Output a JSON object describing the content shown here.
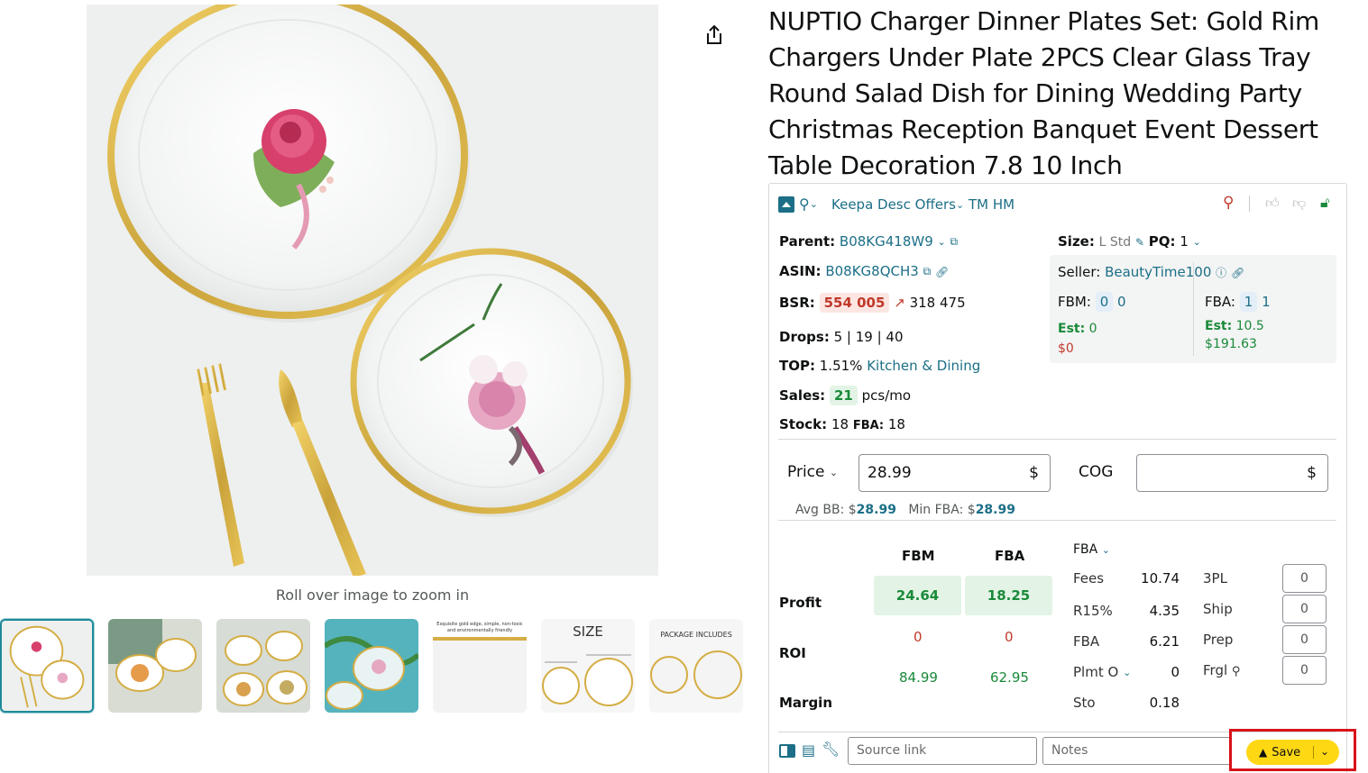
{
  "gallery": {
    "zoom_hint": "Roll over image to zoom in",
    "thumb_size_label": "SIZE",
    "thumb_package_label": "PACKAGE INCLUDES",
    "thumb_text_label": "Exquisite gold edge, simple, non-toxic and environmentally friendly"
  },
  "product": {
    "title": "NUPTIO Charger Dinner Plates Set: Gold Rim Chargers Under Plate 2PCS Clear Glass Tray Round Salad Dish for Dining Wedding Party Christmas Reception Banquet Event Dessert Table Decoration 7.8 10 Inch"
  },
  "keepa": {
    "toolbar": {
      "links": "Keepa Desc Offers",
      "tm_hm": "TM HM"
    },
    "parent": {
      "label": "Parent:",
      "value": "B08KG418W9"
    },
    "asin": {
      "label": "ASIN:",
      "value": "B08KG8QCH3"
    },
    "bsr": {
      "label": "BSR:",
      "value": "554 005",
      "prev": "318 475"
    },
    "drops": {
      "label": "Drops:",
      "value": "5 | 19 | 40"
    },
    "top": {
      "label": "TOP:",
      "value": "1.51%",
      "category": "Kitchen & Dining"
    },
    "sales": {
      "label": "Sales:",
      "value": "21",
      "unit": "pcs/mo"
    },
    "stock": {
      "label": "Stock:",
      "value": "18",
      "fba_label": "FBA:",
      "fba_value": "18"
    },
    "size": {
      "label": "Size:",
      "value": "L Std",
      "pq_label": "PQ:",
      "pq_value": "1"
    },
    "seller": {
      "label": "Seller:",
      "name": "BeautyTime100",
      "fbm_label": "FBM:",
      "fbm_a": "0",
      "fbm_b": "0",
      "fba_label": "FBA:",
      "fba_a": "1",
      "fba_b": "1",
      "est_label": "Est:",
      "est_fbm": "0",
      "est_fbm_money": "$0",
      "est_fba": "10.5",
      "est_fba_money": "$191.63"
    },
    "price": {
      "label": "Price",
      "value": "28.99",
      "currency": "$"
    },
    "cog": {
      "label": "COG",
      "value": "",
      "currency": "$"
    },
    "bb": {
      "avg_label": "Avg BB: $",
      "avg_value": "28.99",
      "min_label": "Min FBA: $",
      "min_value": "28.99"
    },
    "calc": {
      "fbm_header": "FBM",
      "fba_header": "FBA",
      "profit_label": "Profit",
      "roi_label": "ROI",
      "margin_label": "Margin",
      "profit_fbm": "24.64",
      "profit_fba": "18.25",
      "roi_fbm": "0",
      "roi_fba": "0",
      "margin_fbm": "84.99",
      "margin_fba": "62.95"
    },
    "fees": {
      "mode": "FBA",
      "rows": [
        {
          "label": "Fees",
          "value": "10.74"
        },
        {
          "label": "R15%",
          "value": "4.35"
        },
        {
          "label": "FBA",
          "value": "6.21"
        },
        {
          "label": "Plmt O",
          "value": "0"
        },
        {
          "label": "Sto",
          "value": "0.18"
        }
      ],
      "extras": [
        {
          "label": "3PL",
          "value": "0"
        },
        {
          "label": "Ship",
          "value": "0"
        },
        {
          "label": "Prep",
          "value": "0"
        },
        {
          "label": "Frgl",
          "value": "0"
        }
      ]
    },
    "bottom": {
      "source_placeholder": "Source link",
      "notes_placeholder": "Notes",
      "save_label": "Save"
    }
  }
}
